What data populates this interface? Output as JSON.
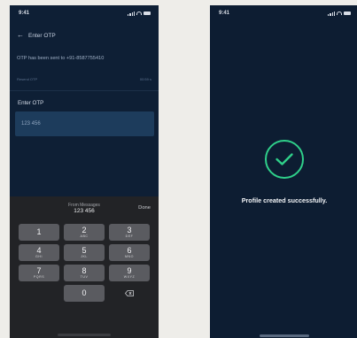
{
  "left_screen": {
    "status_time": "9:41",
    "title": "Enter OTP",
    "otp_info": "OTP has been sent to +91-8587755410",
    "resend_label": "Resend OTP",
    "timer": "00:59 s",
    "enter_label": "Enter OTP",
    "otp_value": "123 456",
    "keyboard": {
      "suggestion_source": "From Messages",
      "suggestion_code": "123 456",
      "done_label": "Done",
      "keys": [
        {
          "num": "1",
          "letters": ""
        },
        {
          "num": "2",
          "letters": "ABC"
        },
        {
          "num": "3",
          "letters": "DEF"
        },
        {
          "num": "4",
          "letters": "GHI"
        },
        {
          "num": "5",
          "letters": "JKL"
        },
        {
          "num": "6",
          "letters": "MNO"
        },
        {
          "num": "7",
          "letters": "PQRS"
        },
        {
          "num": "8",
          "letters": "TUV"
        },
        {
          "num": "9",
          "letters": "WXYZ"
        },
        {
          "num": "0",
          "letters": ""
        }
      ]
    }
  },
  "right_screen": {
    "status_time": "9:41",
    "success_message": "Profile created successfully."
  },
  "icons": {
    "back": "arrow-left-icon",
    "success": "check-circle-icon",
    "backspace": "backspace-icon"
  },
  "colors": {
    "background": "#0e1f35",
    "input": "#1d3c5c",
    "keyboard": "#222326",
    "key": "#5a5b60",
    "success": "#2fd08a"
  }
}
